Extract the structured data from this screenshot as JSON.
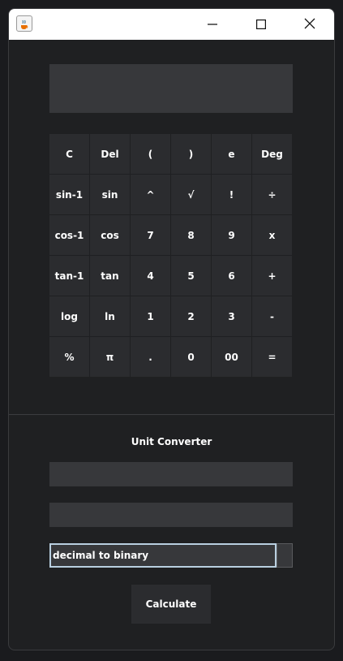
{
  "window": {
    "app_icon": "java-coffee-cup-icon",
    "controls": {
      "minimize_icon": "minimize-icon",
      "maximize_icon": "maximize-icon",
      "close_icon": "close-icon"
    }
  },
  "calculator": {
    "display_value": "",
    "keys": [
      [
        "C",
        "Del",
        "(",
        ")",
        "e",
        "Deg"
      ],
      [
        "sin-1",
        "sin",
        "^",
        "√",
        "!",
        "÷"
      ],
      [
        "cos-1",
        "cos",
        "7",
        "8",
        "9",
        "x"
      ],
      [
        "tan-1",
        "tan",
        "4",
        "5",
        "6",
        "+"
      ],
      [
        "log",
        "ln",
        "1",
        "2",
        "3",
        "-"
      ],
      [
        "%",
        "π",
        ".",
        "0",
        "00",
        "="
      ]
    ]
  },
  "unit_converter": {
    "title": "Unit Converter",
    "input_value": "",
    "output_value": "",
    "conversion_selected": "decimal to binary",
    "calculate_label": "Calculate"
  },
  "colors": {
    "background": "#1f2022",
    "key": "#2b2c2f",
    "field": "#37383b",
    "focus_border": "#b9cfe0",
    "text": "#ffffff"
  }
}
